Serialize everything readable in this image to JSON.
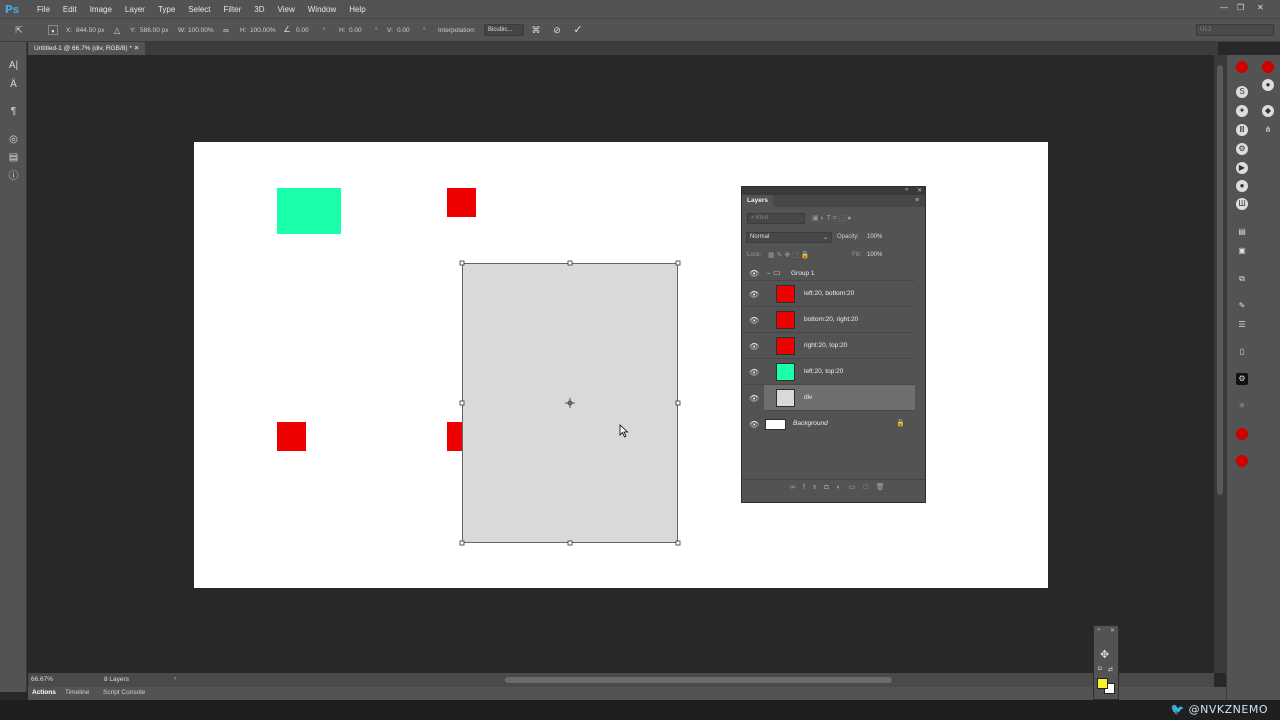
{
  "app": {
    "logo": "Ps"
  },
  "menu": [
    "File",
    "Edit",
    "Image",
    "Layer",
    "Type",
    "Select",
    "Filter",
    "3D",
    "View",
    "Window",
    "Help"
  ],
  "window_controls": {
    "minimize": "—",
    "restore": "❐",
    "close": "✕"
  },
  "options_bar": {
    "x_label": "X:",
    "x_value": "844.50 px",
    "y_label": "Y:",
    "y_value": "586.00 px",
    "w_label": "W:",
    "w_value": "100.00%",
    "h_label": "H:",
    "h_value": "100.00%",
    "angle_value": "0.00",
    "deg1": "°",
    "hskew_label": "H:",
    "hskew_value": "0.00",
    "deg2": "°",
    "vskew_label": "V:",
    "vskew_value": "0.00",
    "deg3": "°",
    "interp_label": "Interpolation:",
    "interp_value": "Bicubic...",
    "cancel_icon": "⃠",
    "commit_icon": "✓",
    "workspace": "UI-2"
  },
  "document_tab": "Untitled-1 @ 66.7% (div, RGB/8) *",
  "status": {
    "zoom": "66.67%",
    "info": "8 Layers"
  },
  "bottom_tabs": [
    "Actions",
    "Timeline",
    "Script Console"
  ],
  "twitter_handle": "@NVKZNEMO",
  "layers_panel": {
    "title": "Layers",
    "filter_placeholder": "Kind",
    "blend_mode": "Normal",
    "opacity_label": "Opacity:",
    "opacity_value": "100%",
    "lock_label": "Lock:",
    "fill_label": "Fill:",
    "fill_value": "100%",
    "layers": [
      {
        "name": "Group 1",
        "type": "group"
      },
      {
        "name": "left:20, bottom:20",
        "color": "#ee0000"
      },
      {
        "name": "bottom:20, right:20",
        "color": "#ee0000"
      },
      {
        "name": "right:20, top:20",
        "color": "#ee0000"
      },
      {
        "name": "left:20, top:20",
        "color": "#1affaa"
      },
      {
        "name": "div",
        "color": "#d9d9d9",
        "selected": true
      },
      {
        "name": "Background",
        "color": "#ffffff",
        "locked": true
      }
    ]
  },
  "colors": {
    "accent_red": "#ee0000",
    "accent_green": "#1affaa",
    "div_gray": "#d9d9d9",
    "foreground_swatch": "#f7f031"
  }
}
